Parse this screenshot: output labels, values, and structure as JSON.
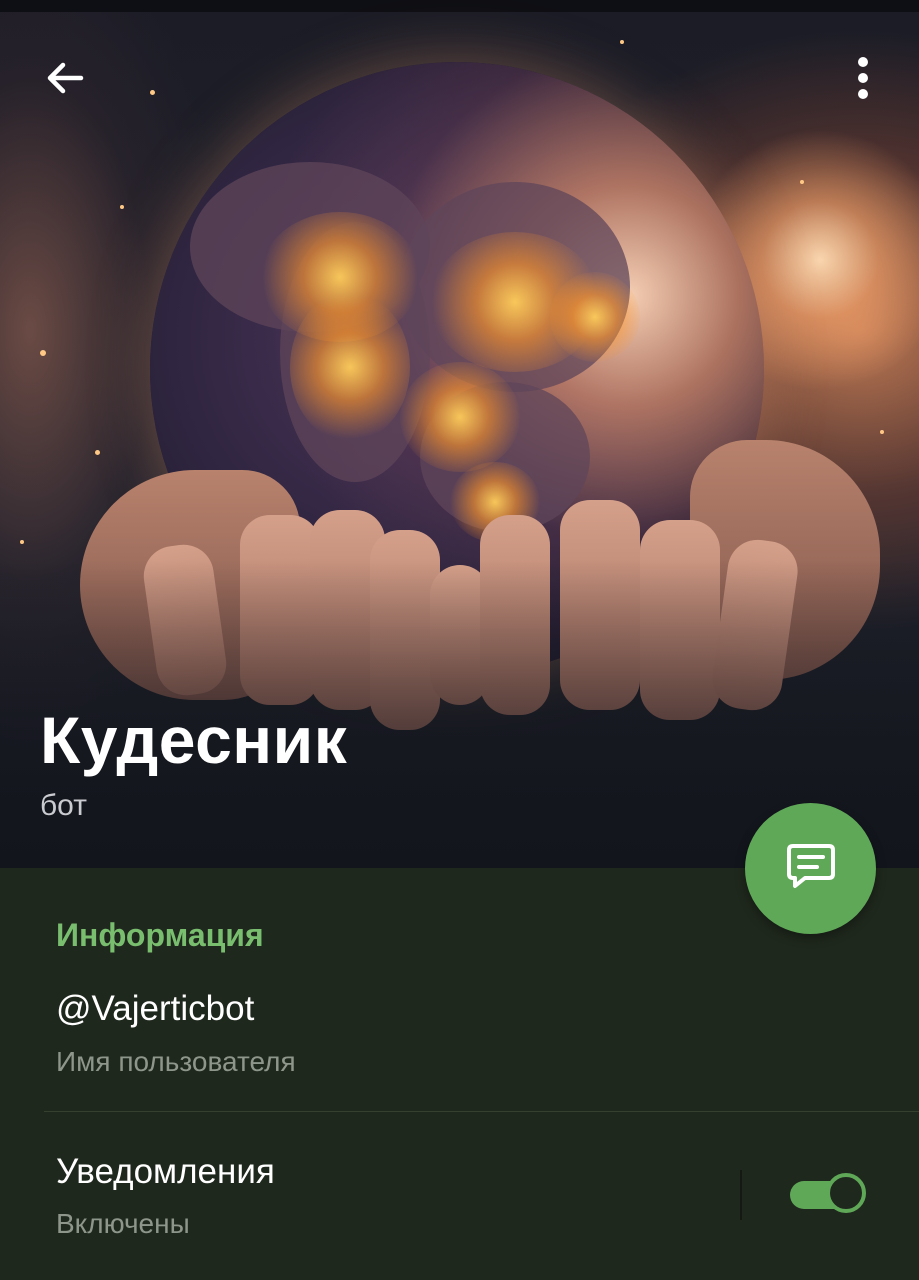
{
  "profile": {
    "name": "Кудесник",
    "subtitle": "бот"
  },
  "info": {
    "section_title": "Информация",
    "username": "@Vajerticbot",
    "username_label": "Имя пользователя"
  },
  "notifications": {
    "title": "Уведомления",
    "status": "Включены",
    "enabled": true
  },
  "icons": {
    "back": "arrow-left-icon",
    "menu": "more-vertical-icon",
    "message": "message-icon"
  },
  "colors": {
    "accent": "#5fa858",
    "section_title": "#79bd6f",
    "background": "#1f281d",
    "secondary_text": "#8e968b"
  }
}
